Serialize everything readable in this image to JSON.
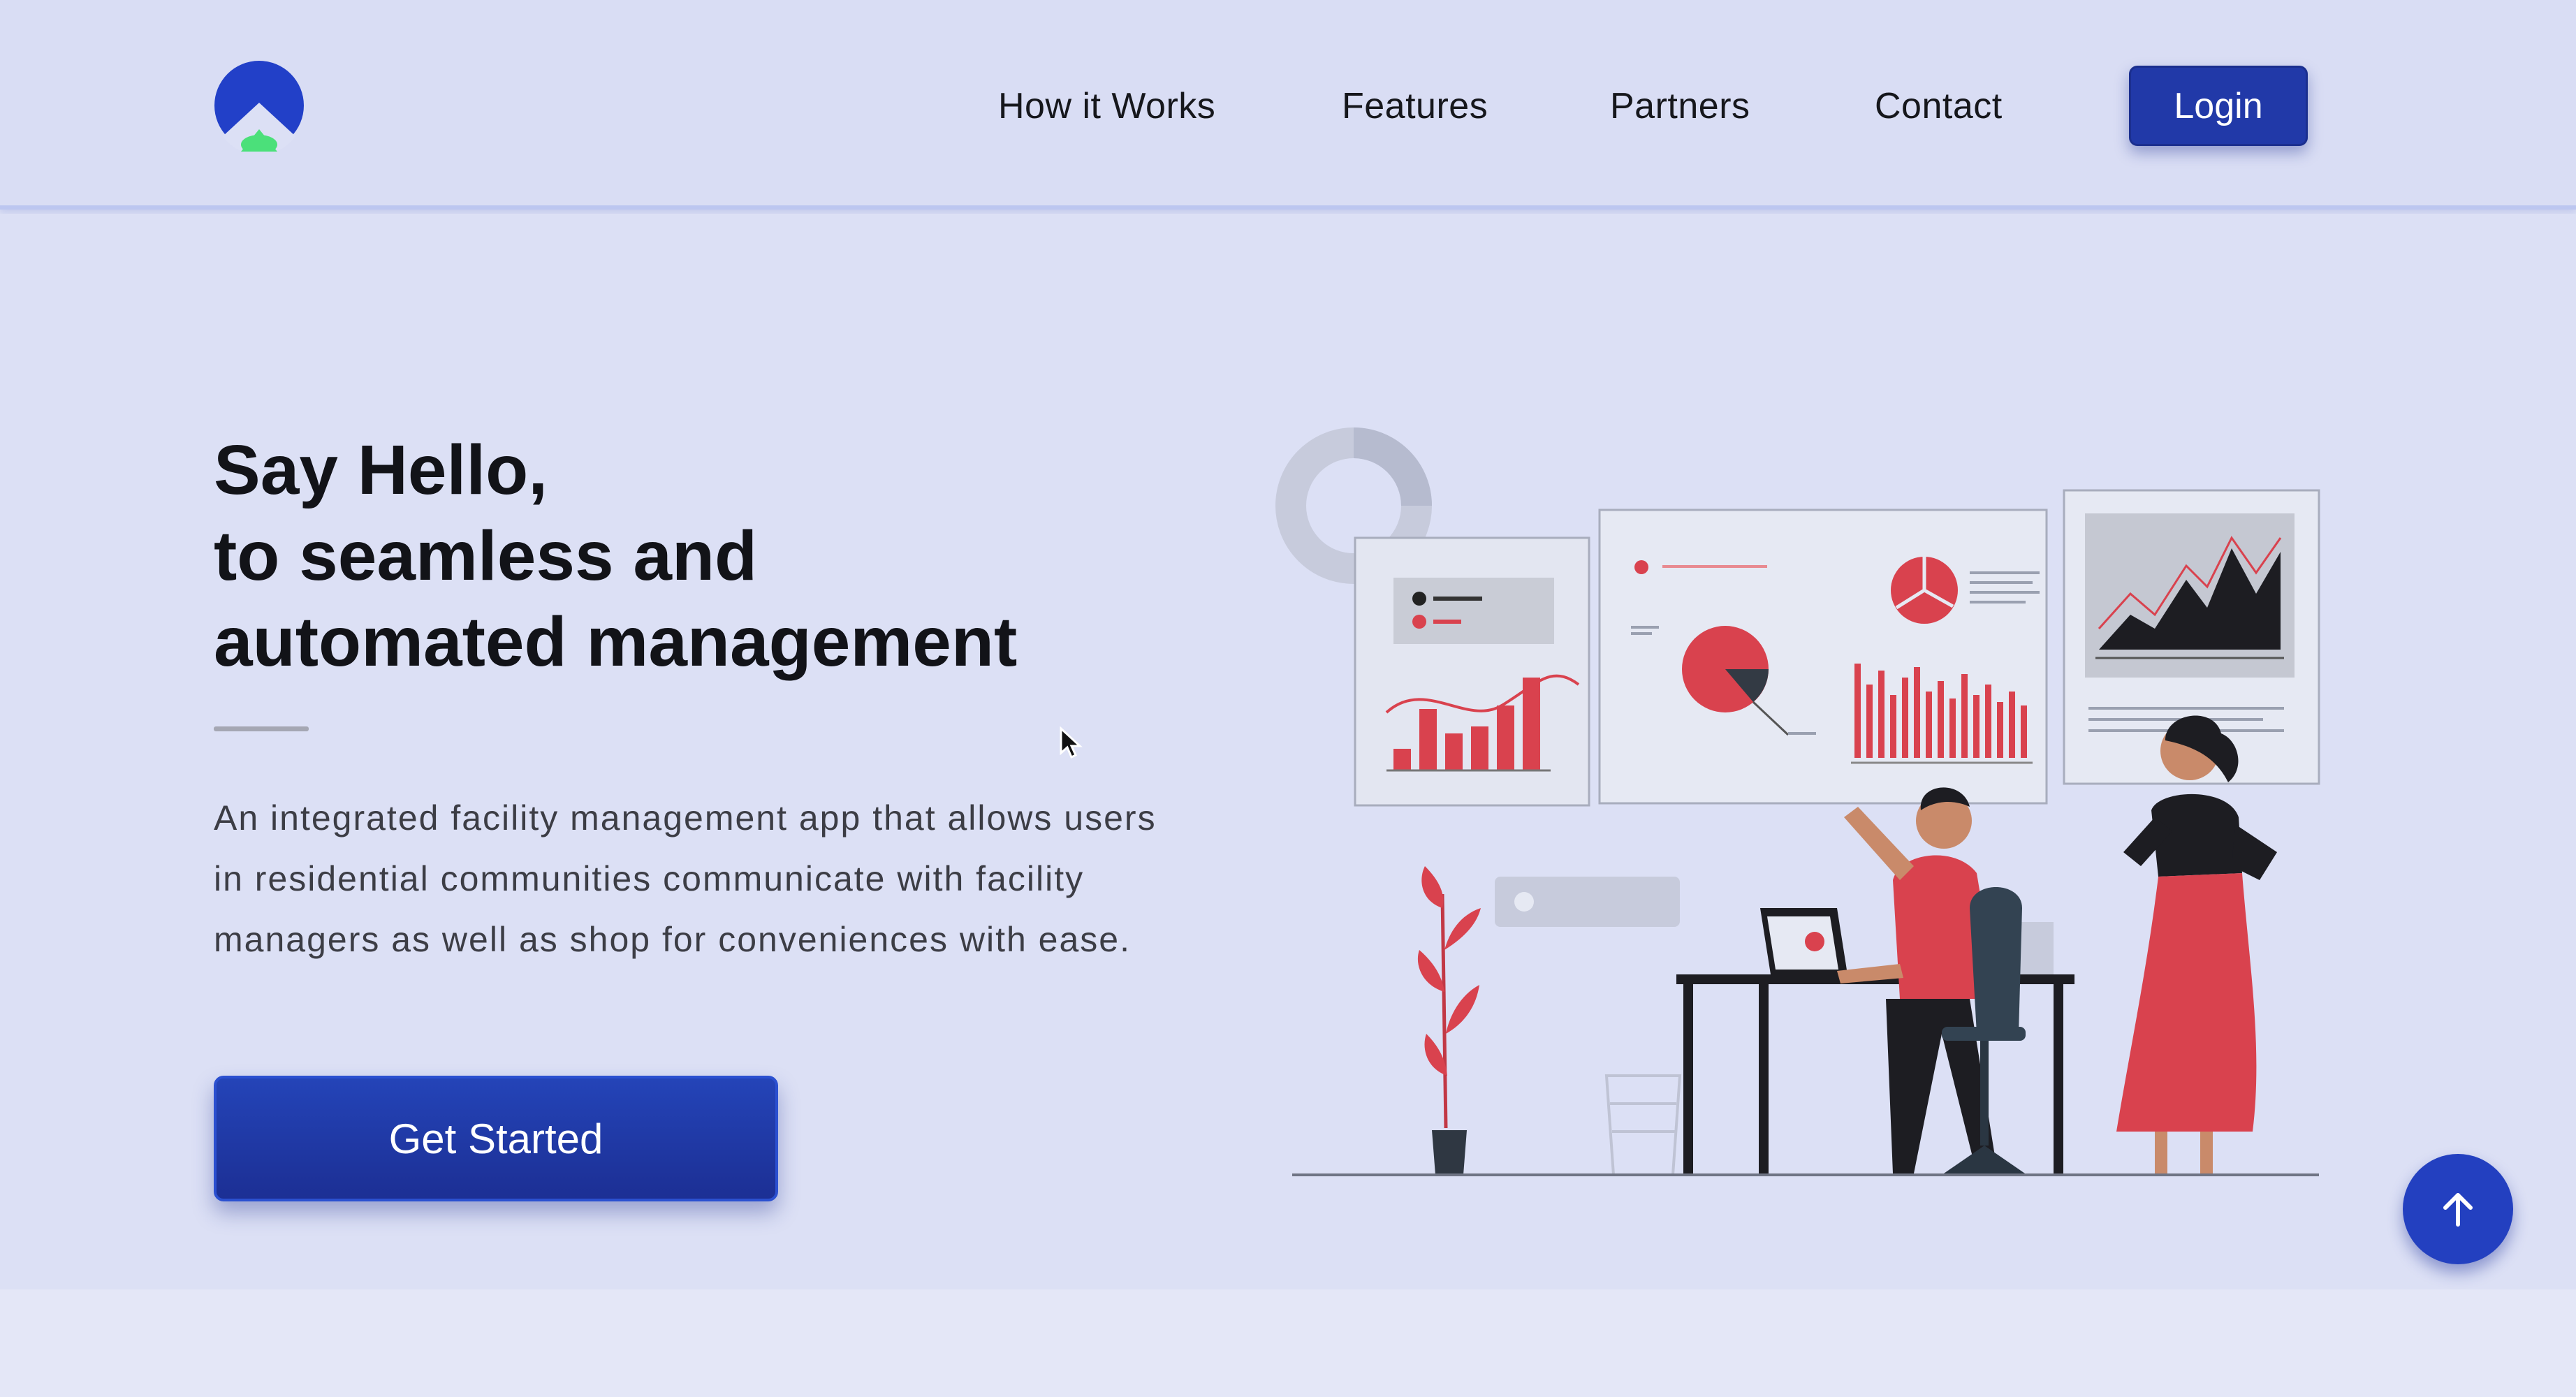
{
  "header": {
    "logo_icon": "brand-logo-icon",
    "nav": [
      "How it Works",
      "Features",
      "Partners",
      "Contact"
    ],
    "login_label": "Login"
  },
  "hero": {
    "headline": [
      "Say Hello,",
      "to seamless and",
      "automated management"
    ],
    "subtext": [
      "An integrated facility management app that allows users",
      "in residential communities communicate with facility",
      "managers as well as shop for conveniences with ease."
    ],
    "cta_label": "Get Started",
    "illustration": "analytics-dashboard-illustration"
  },
  "scroll_top_icon": "arrow-up-icon",
  "colors": {
    "background": "#dce0f5",
    "primary": "#2139a8",
    "accent_red": "#d9424e",
    "logo_green": "#4be07a"
  }
}
